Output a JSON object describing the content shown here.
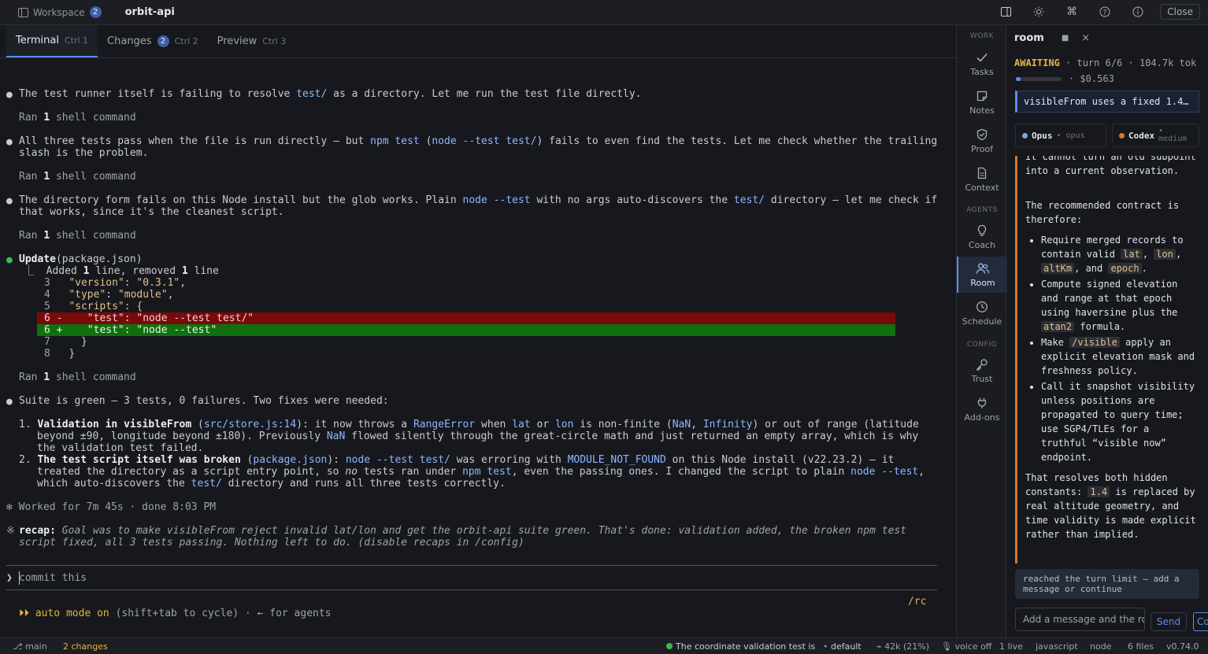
{
  "topbar": {
    "workspace_label": "Workspace",
    "workspace_count": "2",
    "project": "orbit-api",
    "close_label": "Close"
  },
  "tabs": [
    {
      "label": "Terminal",
      "shortcut": "Ctrl 1"
    },
    {
      "label": "Changes",
      "badge": "2",
      "shortcut": "Ctrl 2"
    },
    {
      "label": "Preview",
      "shortcut": "Ctrl 3"
    }
  ],
  "terminal": {
    "m1": {
      "a": "The test runner itself is failing to resolve ",
      "b": "test/",
      "c": " as a directory. Let me run the test file directly."
    },
    "ran": {
      "a": "Ran ",
      "n": "1",
      "b": " shell command"
    },
    "m2": {
      "a": "All three tests pass when the file is run directly — but ",
      "b": "npm test",
      "c": " (",
      "d": "node --test test/",
      "e": ") fails to even find the tests. Let me check whether the trailing",
      "l2": "slash is the problem."
    },
    "m3": {
      "a": "The directory form fails on this Node install but the glob works. Plain ",
      "b": "node --test",
      "c": " with no args auto-discovers the ",
      "d": "test/",
      "e": " directory — let me check if",
      "l2": "that works, since it's the cleanest script."
    },
    "update": {
      "title": "Update",
      "file": "(package.json)",
      "summary_a": "⎿  Added ",
      "summary_n1": "1",
      "summary_b": " line, removed ",
      "summary_n2": "1",
      "summary_c": " line"
    },
    "diff": {
      "l3": {
        "num": "3",
        "key": "\"version\"",
        "sep": ": ",
        "val": "\"0.3.1\"",
        "end": ","
      },
      "l4": {
        "num": "4",
        "key": "\"type\"",
        "sep": ": ",
        "val": "\"module\"",
        "end": ","
      },
      "l5": {
        "num": "5",
        "text": "\"scripts\": {"
      },
      "del": "6 -    \"test\": \"node --test test/\"",
      "add": "6 +    \"test\": \"node --test\"",
      "l7": {
        "num": "7",
        "text": "}"
      },
      "l8": {
        "num": "8",
        "text": "}"
      }
    },
    "m4": "Suite is green — 3 tests, 0 failures. Two fixes were needed:",
    "fix1": {
      "num": "1.",
      "title": "Validation in ",
      "fn": "visibleFrom",
      "a": " (",
      "loc": "src/store.js:14",
      "b": "): it now throws a ",
      "err": "RangeError",
      "c": " when ",
      "lat": "lat",
      "d": " or ",
      "lon": "lon",
      "e": " is non-finite (",
      "nan": "NaN",
      "f": ", ",
      "inf": "Infinity",
      "g": ") or out of range (latitude",
      "l2a": "beyond ±90, longitude beyond ±180). Previously ",
      "l2nan": "NaN",
      "l2b": " flowed silently through the great-circle math and just returned an empty array, which is why",
      "l3": "the validation test failed."
    },
    "fix2": {
      "num": "2.",
      "title": "The test script itself was broken",
      "a": " (",
      "loc": "package.json",
      "b": "): ",
      "cmd": "node --test test/",
      "c": " was erroring with ",
      "err": "MODULE_NOT_FOUND",
      "d": " on this Node install (v22.23.2) — it",
      "l2a": "treated the directory as a script entry point, so ",
      "no": "no",
      "l2b": " tests ran under ",
      "npm": "npm test",
      "l2c": ", even the passing ones. I changed the script to plain ",
      "node": "node --test",
      "l2d": ",",
      "l3a": "which auto-discovers the ",
      "l3dir": "test/",
      "l3b": " directory and runs all three tests correctly."
    },
    "worked": "✻ Worked for 7m 45s · done 8:03 PM",
    "recap_sym": "※",
    "recap_label": "recap:",
    "recap_l1": " Goal was to make visibleFrom reject invalid lat/lon and get the orbit-api suite green. That's done: validation added, the broken npm test",
    "recap_l2": "script fixed, all 3 tests passing. Nothing left to do. (disable recaps in /config)",
    "prompt_sym": "❯",
    "prompt_value": "commit this",
    "rc": "/rc",
    "mode_sym": "⏵⏵",
    "mode_on": "auto mode on",
    "mode_rest": " (shift+tab to cycle) · ← for agents"
  },
  "sidebar": {
    "sections": {
      "work": "WORK",
      "agents": "AGENTS",
      "config": "CONFIG"
    },
    "items": [
      {
        "label": "Tasks",
        "icon": "check-icon"
      },
      {
        "label": "Notes",
        "icon": "note-icon"
      },
      {
        "label": "Proof",
        "icon": "shield-icon"
      },
      {
        "label": "Context",
        "icon": "document-icon"
      },
      {
        "label": "Coach",
        "icon": "lightbulb-icon"
      },
      {
        "label": "Room",
        "icon": "users-icon"
      },
      {
        "label": "Schedule",
        "icon": "clock-icon"
      },
      {
        "label": "Trust",
        "icon": "key-icon"
      },
      {
        "label": "Add-ons",
        "icon": "plug-icon"
      }
    ]
  },
  "room": {
    "title": "room",
    "stop_icon": "■",
    "close_icon": "×",
    "status": "AWAITING",
    "status_rest": " · turn 6/6 · 104.7k tok",
    "progress": 0.1,
    "cost": "· $0.563",
    "question": "visibleFrom uses a fixed 1.4…",
    "agents": [
      {
        "name": "Opus",
        "sub": "• opus",
        "color": "#7fa3e8"
      },
      {
        "name": "Codex",
        "sub": "• medium",
        "color": "#d4772c"
      }
    ],
    "body": {
      "p0": "It cannot turn an old subpoint into a current observation.",
      "p1": "The recommended contract is therefore:",
      "li1a": "Require merged records to contain valid ",
      "lat": "lat",
      "li1b": ", ",
      "lon": "lon",
      "li1c": ",",
      "altKm": "altKm",
      "li1d": ", and ",
      "epoch": "epoch",
      "li1e": ".",
      "li2a": "Compute signed elevation and range at that epoch using haversine plus the ",
      "atan2": "atan2",
      "li2b": " formula.",
      "li3a": "Make ",
      "visible": "/visible",
      "li3b": " apply an explicit elevation mask and freshness policy.",
      "li4": "Call it snapshot visibility unless positions are propagated to query time; use SGP4/TLEs for a truthful “visible now” endpoint.",
      "p2a": "That resolves both hidden constants: ",
      "c14": "1.4",
      "p2b": " is replaced by real altitude geometry, and time validity is made explicit rather than implied."
    },
    "limit": "reached the turn limit — add a message or continue",
    "input_placeholder": "Add a message and the roo",
    "send": "Send",
    "continue": "Co"
  },
  "status": {
    "branch": "main",
    "changes": "2 changes",
    "task": "The coordinate validation test is",
    "profile": "default",
    "tokens": "42k (21%)",
    "voice": "voice off",
    "lines": "1 live",
    "lang": "javascript",
    "runtime": "node",
    "files": "6 files",
    "version": "v0.74.0"
  }
}
